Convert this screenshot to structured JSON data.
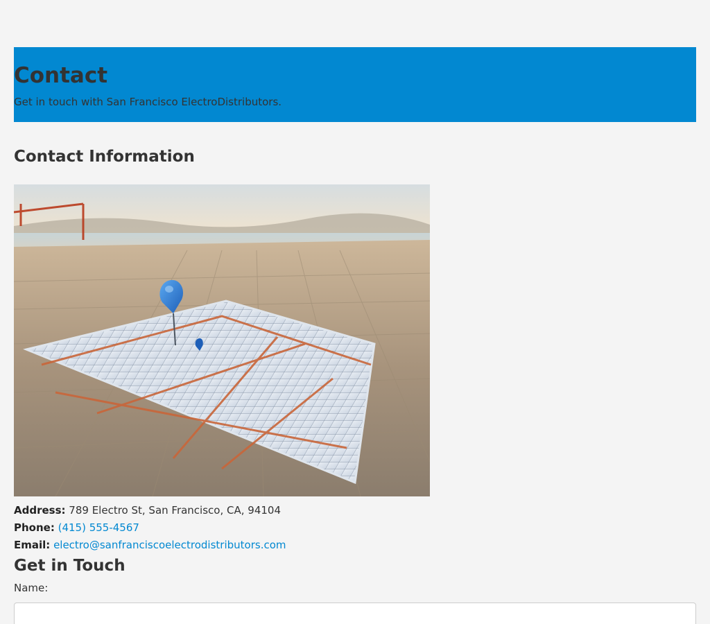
{
  "hero": {
    "title": "Contact",
    "subtitle": "Get in touch with San Francisco ElectroDistributors."
  },
  "contact_info": {
    "heading": "Contact Information",
    "address_label": "Address:",
    "address_value": "789 Electro St, San Francisco, CA, 94104",
    "phone_label": "Phone:",
    "phone_value": "(415) 555-4567",
    "email_label": "Email:",
    "email_value": "electro@sanfranciscoelectrodistributors.com"
  },
  "form": {
    "heading": "Get in Touch",
    "name_label": "Name:",
    "name_value": ""
  },
  "colors": {
    "hero_background": "#0288d1",
    "link": "#0288d1",
    "page_background": "#f4f4f4",
    "text": "#333333",
    "map_pin": "#1e6fd0"
  },
  "icons": {
    "map_pin": "map-pin-icon"
  }
}
